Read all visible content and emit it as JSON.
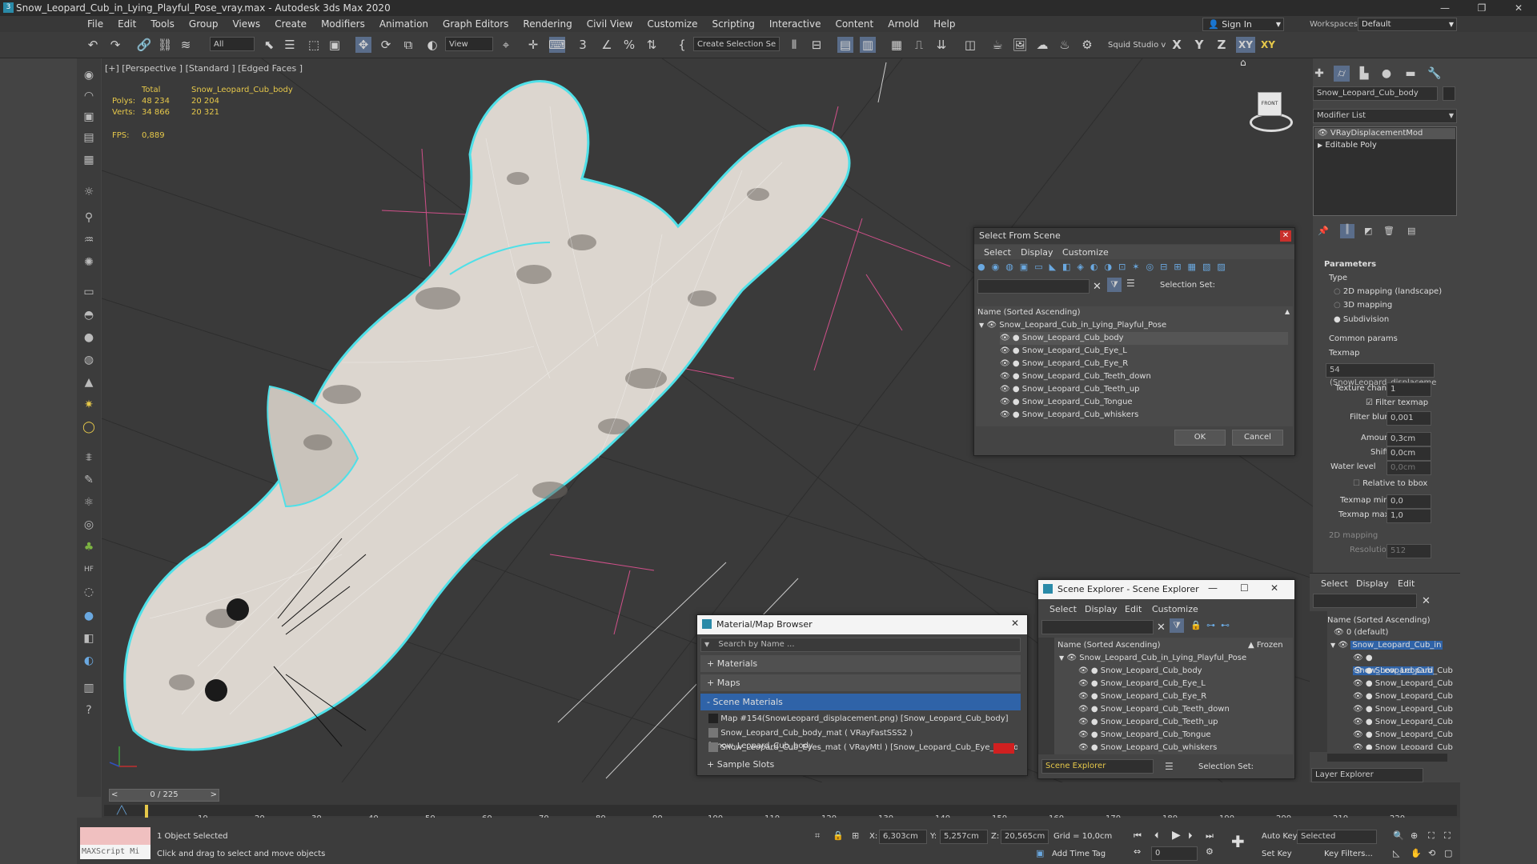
{
  "window": {
    "title": "Snow_Leopard_Cub_in_Lying_Playful_Pose_vray.max - Autodesk 3ds Max 2020",
    "minimize": "—",
    "maximize": "❐",
    "close": "✕"
  },
  "menu": [
    "File",
    "Edit",
    "Tools",
    "Group",
    "Views",
    "Create",
    "Modifiers",
    "Animation",
    "Graph Editors",
    "Rendering",
    "Civil View",
    "Customize",
    "Scripting",
    "Interactive",
    "Content",
    "Arnold",
    "Help"
  ],
  "signin": "Sign In",
  "workspaces_label": "Workspaces:",
  "workspace": "Default",
  "toolbar": {
    "filter": "All",
    "refcoord": "View",
    "selection_set": "Create Selection Se",
    "studio": "Squid Studio v",
    "axes": [
      "X",
      "Y",
      "Z",
      "XY",
      "XY"
    ]
  },
  "viewport": {
    "label": "[+] [Perspective ] [Standard ] [Edged Faces ]",
    "stats": {
      "total_header": "Total",
      "obj_header": "Snow_Leopard_Cub_body",
      "polys_label": "Polys:",
      "polys_total": "48 234",
      "polys_obj": "20 204",
      "verts_label": "Verts:",
      "verts_total": "34 866",
      "verts_obj": "20 321",
      "fps_label": "FPS:",
      "fps": "0,889"
    },
    "viewcube": "FRONT"
  },
  "command_panel": {
    "object_name": "Snow_Leopard_Cub_body",
    "modifier_list": "Modifier List",
    "stack": [
      "VRayDisplacementMod",
      "Editable Poly"
    ],
    "parameters": "Parameters",
    "type_label": "Type",
    "types": [
      "2D mapping (landscape)",
      "3D mapping",
      "Subdivision"
    ],
    "common": "Common params",
    "texmap": "Texmap",
    "texmap_value": "54 (SnowLeopard_displaceme",
    "texture_chan": "Texture chan",
    "texture_chan_v": "1",
    "filter_texmap": "Filter texmap",
    "filter_blur": "Filter blur",
    "filter_blur_v": "0,001",
    "amount": "Amount",
    "amount_v": "0,3cm",
    "shift": "Shift",
    "shift_v": "0,0cm",
    "water": "Water level",
    "water_v": "0,0cm",
    "relative": "Relative to bbox",
    "texmin": "Texmap min",
    "texmin_v": "0,0",
    "texmax": "Texmap max",
    "texmax_v": "1,0",
    "mapping2d": "2D mapping",
    "resolution": "Resolution",
    "resolution_v": "512"
  },
  "select_from_scene": {
    "title": "Select From Scene",
    "menus": [
      "Select",
      "Display",
      "Customize"
    ],
    "selection_set": "Selection Set:",
    "column": "Name (Sorted Ascending)",
    "root": "Snow_Leopard_Cub_in_Lying_Playful_Pose",
    "items": [
      "Snow_Leopard_Cub_body",
      "Snow_Leopard_Cub_Eye_L",
      "Snow_Leopard_Cub_Eye_R",
      "Snow_Leopard_Cub_Teeth_down",
      "Snow_Leopard_Cub_Teeth_up",
      "Snow_Leopard_Cub_Tongue",
      "Snow_Leopard_Cub_whiskers"
    ],
    "ok": "OK",
    "cancel": "Cancel"
  },
  "scene_explorer": {
    "title": "Scene Explorer - Scene Explorer",
    "menus": [
      "Select",
      "Display",
      "Edit",
      "Customize"
    ],
    "column": "Name (Sorted Ascending)",
    "frozen": "▲ Frozen",
    "root": "Snow_Leopard_Cub_in_Lying_Playful_Pose",
    "items": [
      "Snow_Leopard_Cub_body",
      "Snow_Leopard_Cub_Eye_L",
      "Snow_Leopard_Cub_Eye_R",
      "Snow_Leopard_Cub_Teeth_down",
      "Snow_Leopard_Cub_Teeth_up",
      "Snow_Leopard_Cub_Tongue",
      "Snow_Leopard_Cub_whiskers"
    ],
    "footer_name": "Scene Explorer",
    "selection_set": "Selection Set:"
  },
  "right_explorer": {
    "menus": [
      "Select",
      "Display",
      "Edit"
    ],
    "column": "Name (Sorted Ascending)",
    "default_layer": "0 (default)",
    "root": "Snow_Leopard_Cub_in",
    "items": [
      "Snow_Leopard_Cub",
      "Snow_Leopard_Cub",
      "Snow_Leopard_Cub",
      "Snow_Leopard_Cub",
      "Snow_Leopard_Cub",
      "Snow_Leopard_Cub",
      "Snow_Leopard_Cub",
      "Snow_Leopard_Cub"
    ],
    "footer": "Layer Explorer"
  },
  "material_browser": {
    "title": "Material/Map Browser",
    "search": "Search by Name ...",
    "groups": [
      "+ Materials",
      "+ Maps",
      "- Scene Materials"
    ],
    "entries": [
      "Map #154(SnowLeopard_displacement.png) [Snow_Leopard_Cub_body]",
      "Snow_Leopard_Cub_body_mat ( VRayFastSSS2 ) [Snow_Leopard_Cub_body...",
      "Snow_Leopard_Cub_Eyes_mat ( VRayMtl ) [Snow_Leopard_Cub_Eye_L, Sno..."
    ],
    "sample_slots": "+ Sample Slots"
  },
  "timeline": {
    "frame": "0 / 225",
    "ticks": [
      "10",
      "20",
      "30",
      "40",
      "50",
      "60",
      "70",
      "80",
      "90",
      "100",
      "110",
      "120",
      "130",
      "140",
      "150",
      "160",
      "170",
      "180",
      "190",
      "200",
      "210",
      "220"
    ]
  },
  "status": {
    "maxscript": "MAXScript Mi",
    "selected": "1 Object Selected",
    "hint": "Click and drag to select and move objects",
    "x_label": "X:",
    "x": "6,303cm",
    "y_label": "Y:",
    "y": "5,257cm",
    "z_label": "Z:",
    "z": "20,565cm",
    "grid": "Grid = 10,0cm",
    "add_time_tag": "Add Time Tag",
    "auto_key": "Auto Key",
    "set_key": "Set Key",
    "key_mode": "Selected",
    "key_filters": "Key Filters...",
    "frame_field": "0"
  },
  "colors": {
    "selection_outline": "#4fe0e8",
    "highlight": "#2f63a8",
    "stat_text": "#e6c84a",
    "red_swatch": "#d02020"
  }
}
